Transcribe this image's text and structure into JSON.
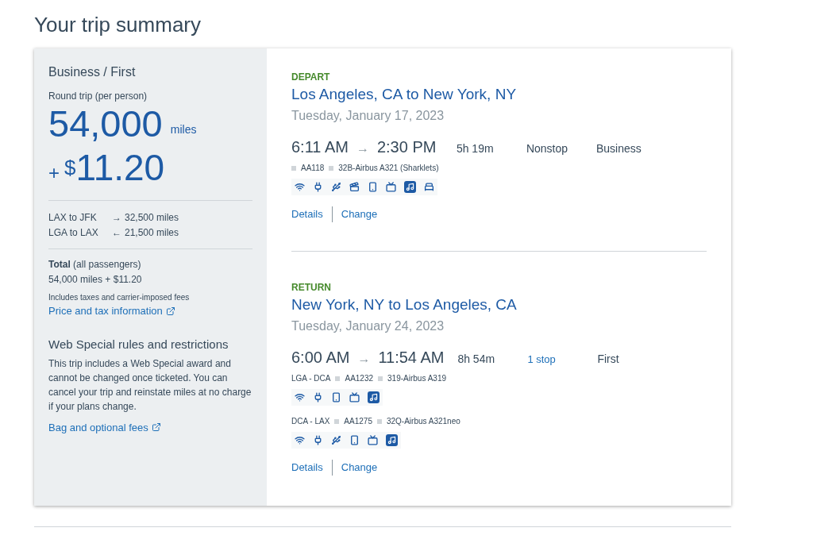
{
  "title": "Your trip summary",
  "summary": {
    "cabin": "Business / First",
    "trip_type": "Round trip (per person)",
    "miles": "54,000",
    "miles_unit": "miles",
    "plus": "+",
    "currency": "$",
    "amount": "11.20",
    "legs": [
      {
        "route": "LAX to JFK",
        "arrow": "→",
        "miles": "32,500 miles"
      },
      {
        "route": "LGA to LAX",
        "arrow": "←",
        "miles": "21,500 miles"
      }
    ],
    "total_label": "**Total** (all passengers)",
    "total": "54,000 miles + $11.20",
    "fees_note": "Includes taxes and carrier-imposed fees",
    "price_link": "Price and tax information",
    "rules_title": "Web Special rules and restrictions",
    "rules_text": "This trip includes a Web Special award and cannot be changed once ticketed. You can cancel your trip and reinstate miles at no charge if your plans change.",
    "bag_link": "Bag and optional fees"
  },
  "flights": [
    {
      "label": "DEPART",
      "route": "Los Angeles, CA to New York, NY",
      "date": "Tuesday, January 17, 2023",
      "depart_time": "6:11 AM",
      "arrow": "→",
      "arrive_time": "2:30 PM",
      "duration": "5h 19m",
      "stops": {
        "text": "Nonstop",
        "kind": "plain"
      },
      "cabin": "Business",
      "segments": [
        {
          "flight": "AA118",
          "aircraft": "32B-Airbus A321 (Sharklets)",
          "amenities": [
            {
              "kind": "wifi"
            },
            {
              "kind": "power"
            },
            {
              "kind": "usb"
            },
            {
              "kind": "video"
            },
            {
              "kind": "phone"
            },
            {
              "kind": "tv"
            },
            {
              "kind": "music"
            },
            {
              "kind": "bed"
            }
          ]
        }
      ],
      "links": [
        "Details",
        "Change"
      ]
    },
    {
      "label": "RETURN",
      "route": "New York, NY to Los Angeles, CA",
      "date": "Tuesday, January 24, 2023",
      "depart_time": "6:00 AM",
      "arrow": "→",
      "arrive_time": "11:54 AM",
      "duration": "8h 54m",
      "stops": {
        "text": "1 stop",
        "kind": "link"
      },
      "cabin": "First",
      "segments": [
        {
          "route": "LGA - DCA",
          "flight": "AA1232",
          "aircraft": "319-Airbus A319",
          "amenities": [
            {
              "kind": "wifi"
            },
            {
              "kind": "power"
            },
            {
              "kind": "phone"
            },
            {
              "kind": "tv"
            },
            {
              "kind": "music"
            }
          ]
        },
        {
          "route": "DCA - LAX",
          "flight": "AA1275",
          "aircraft": "32Q-Airbus A321neo",
          "amenities": [
            {
              "kind": "wifi"
            },
            {
              "kind": "power"
            },
            {
              "kind": "usb"
            },
            {
              "kind": "phone"
            },
            {
              "kind": "tv"
            },
            {
              "kind": "music"
            }
          ]
        }
      ],
      "links": [
        "Details",
        "Change"
      ]
    }
  ]
}
